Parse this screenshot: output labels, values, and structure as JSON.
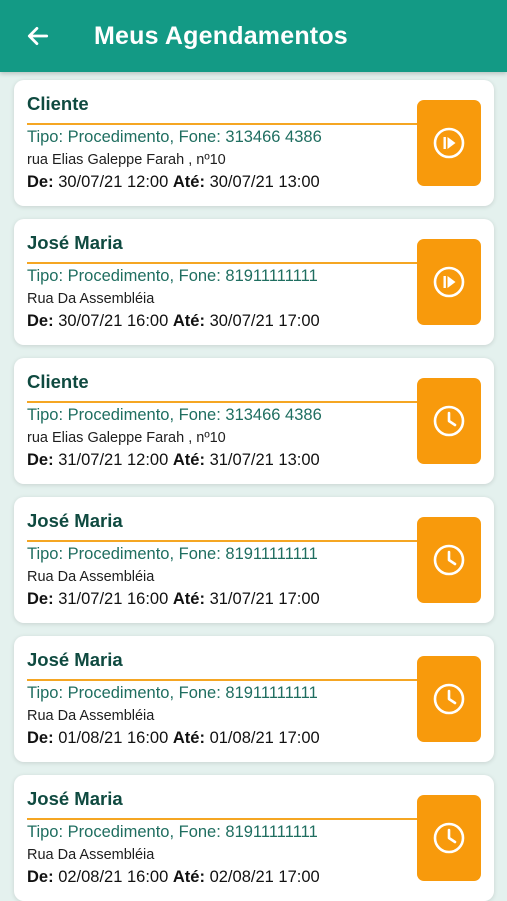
{
  "header": {
    "title": "Meus Agendamentos"
  },
  "appointments": [
    {
      "name": "Cliente",
      "tipo": "Tipo: Procedimento, Fone: 313466 4386",
      "address": "rua Elias Galeppe Farah , nº10",
      "de_label": "De:",
      "de_value": "30/07/21  12:00",
      "ate_label": "Até:",
      "ate_value": "30/07/21  13:00",
      "icon": "play-circle-icon"
    },
    {
      "name": "José Maria",
      "tipo": "Tipo: Procedimento, Fone: 81911111111",
      "address": "Rua Da Assembléia",
      "de_label": "De:",
      "de_value": "30/07/21  16:00",
      "ate_label": "Até:",
      "ate_value": "30/07/21  17:00",
      "icon": "play-circle-icon"
    },
    {
      "name": "Cliente",
      "tipo": "Tipo: Procedimento, Fone: 313466 4386",
      "address": "rua Elias Galeppe Farah , nº10",
      "de_label": "De:",
      "de_value": "31/07/21  12:00",
      "ate_label": "Até:",
      "ate_value": "31/07/21  13:00",
      "icon": "clock-icon"
    },
    {
      "name": "José Maria",
      "tipo": "Tipo: Procedimento, Fone: 81911111111",
      "address": "Rua Da Assembléia",
      "de_label": "De:",
      "de_value": "31/07/21  16:00",
      "ate_label": "Até:",
      "ate_value": "31/07/21  17:00",
      "icon": "clock-icon"
    },
    {
      "name": "José Maria",
      "tipo": "Tipo: Procedimento, Fone: 81911111111",
      "address": "Rua Da Assembléia",
      "de_label": "De:",
      "de_value": "01/08/21  16:00",
      "ate_label": "Até:",
      "ate_value": "01/08/21  17:00",
      "icon": "clock-icon"
    },
    {
      "name": "José Maria",
      "tipo": "Tipo: Procedimento, Fone: 81911111111",
      "address": "Rua Da Assembléia",
      "de_label": "De:",
      "de_value": "02/08/21  16:00",
      "ate_label": "Até:",
      "ate_value": "02/08/21  17:00",
      "icon": "clock-icon"
    }
  ],
  "colors": {
    "header": "#139a85",
    "accent": "#f89a0c",
    "background": "#e4f1ee",
    "name_text": "#0f4a40"
  }
}
